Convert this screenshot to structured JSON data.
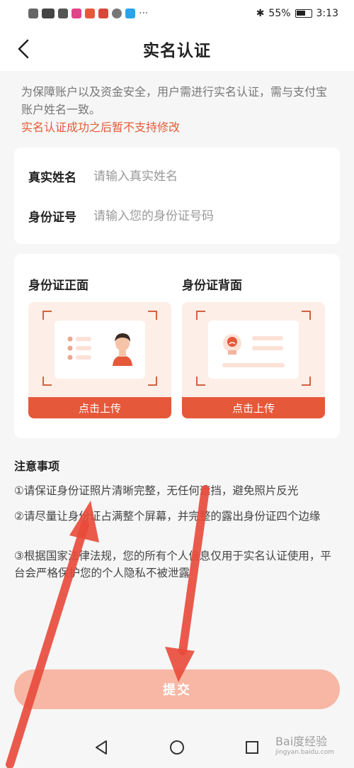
{
  "status": {
    "battery": "55%",
    "time": "3:13"
  },
  "header": {
    "title": "实名认证"
  },
  "intro": {
    "text": "为保障账户以及资金安全，用户需进行实名认证，需与支付宝账户姓名一致。",
    "warning": "实名认证成功之后暂不支持修改"
  },
  "form": {
    "name_label": "真实姓名",
    "name_placeholder": "请输入真实姓名",
    "id_label": "身份证号",
    "id_placeholder": "请输入您的身份证号码"
  },
  "upload": {
    "front_label": "身份证正面",
    "back_label": "身份证背面",
    "button_label": "点击上传"
  },
  "notes": {
    "title": "注意事项",
    "items": [
      "①请保证身份证照片清晰完整，无任何遮挡，避免照片反光",
      "②请尽量让身份证占满整个屏幕，并完整的露出身份证四个边缘",
      "③根据国家法律法规，您的所有个人信息仅用于实名认证使用，平台会严格保护您的个人隐私不被泄露"
    ]
  },
  "submit_label": "提交",
  "watermark": {
    "brand": "Bai度经验",
    "url": "jingyan.baidu.com"
  },
  "colors": {
    "accent": "#e6583a",
    "warning": "#e45b36",
    "submit_disabled": "#f7b7a4",
    "annotation_arrow": "#e94a3a"
  }
}
